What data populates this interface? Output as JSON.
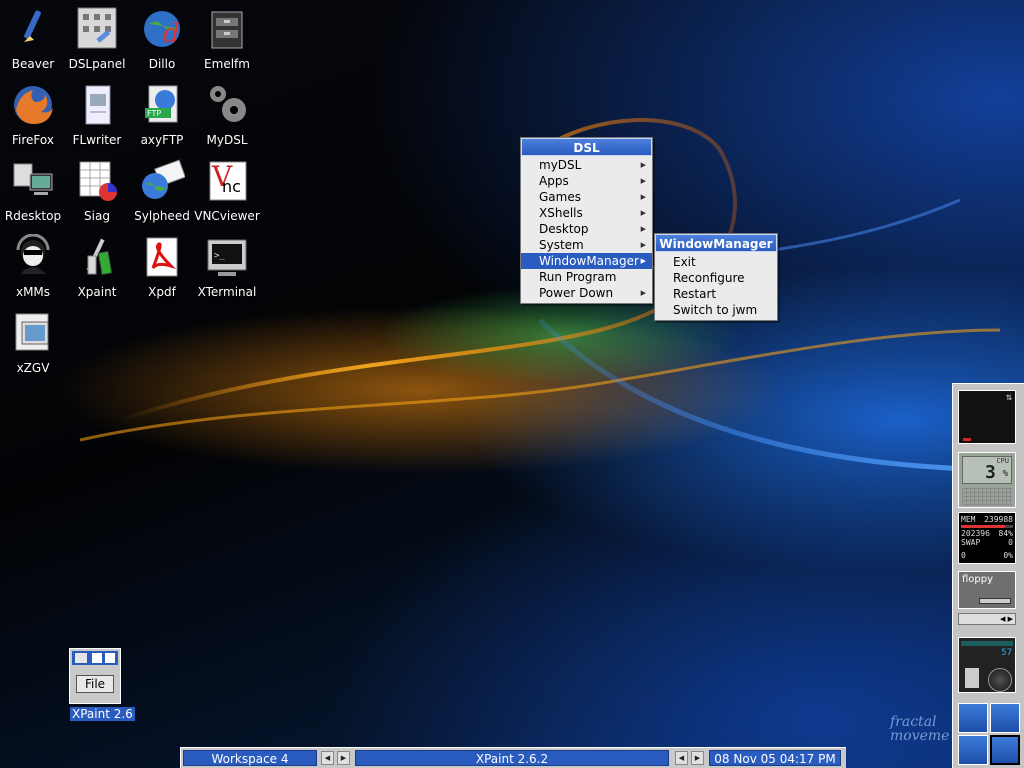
{
  "desktop_icons": [
    {
      "label": "Beaver"
    },
    {
      "label": "DSLpanel"
    },
    {
      "label": "Dillo"
    },
    {
      "label": "Emelfm"
    },
    {
      "label": "FireFox"
    },
    {
      "label": "FLwriter"
    },
    {
      "label": "axyFTP"
    },
    {
      "label": "MyDSL"
    },
    {
      "label": "Rdesktop"
    },
    {
      "label": "Siag"
    },
    {
      "label": "Sylpheed"
    },
    {
      "label": "VNCviewer"
    },
    {
      "label": "xMMs"
    },
    {
      "label": "Xpaint"
    },
    {
      "label": "Xpdf"
    },
    {
      "label": "XTerminal"
    },
    {
      "label": "xZGV"
    }
  ],
  "menu": {
    "title": "DSL",
    "items": [
      {
        "label": "myDSL",
        "submenu": true
      },
      {
        "label": "Apps",
        "submenu": true
      },
      {
        "label": "Games",
        "submenu": true
      },
      {
        "label": "XShells",
        "submenu": true
      },
      {
        "label": "Desktop",
        "submenu": true
      },
      {
        "label": "System",
        "submenu": true
      },
      {
        "label": "WindowManager",
        "submenu": true,
        "selected": true
      },
      {
        "label": "Run Program",
        "submenu": false
      },
      {
        "label": "Power Down",
        "submenu": true
      }
    ]
  },
  "submenu": {
    "title": "WindowManager",
    "items": [
      "Exit",
      "Reconfigure",
      "Restart",
      "Switch to jwm"
    ]
  },
  "iconified_window": {
    "file_button": "File",
    "label": "XPaint 2.6"
  },
  "taskbar": {
    "workspace": "Workspace 4",
    "task": "XPaint 2.6.2",
    "clock": "08 Nov 05 04:17 PM"
  },
  "dock": {
    "cpu_label": "CPU",
    "cpu_value": "3",
    "mem_label": "MEM",
    "mem_value": "239988",
    "mem2_value": "202396",
    "mem_pct": "84%",
    "swap_label": "SWAP",
    "swap_value": "0",
    "swap2_value": "0",
    "swap_pct": "0%",
    "floppy_label": "floppy",
    "mixer_value": "57"
  },
  "wallpaper_text": {
    "line1": "fractal",
    "line2": "moveme"
  }
}
